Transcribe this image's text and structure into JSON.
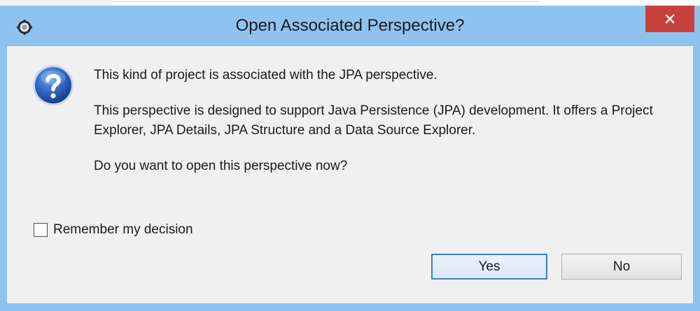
{
  "window": {
    "title": "Open Associated Perspective?",
    "close_glyph": "✕"
  },
  "colors": {
    "titlebar": "#8fc3ef",
    "close_button": "#c7413a",
    "client_background": "#f0f0f0",
    "default_button_border": "#3c7fd1"
  },
  "icons": {
    "app": "eclipse-gear-icon",
    "message": "question-mark-icon",
    "close": "close-icon"
  },
  "message": {
    "line1": "This kind of project is associated with the JPA perspective.",
    "line2": "This perspective is designed to support Java Persistence (JPA) development. It offers a Project Explorer, JPA Details, JPA Structure and a Data Source Explorer.",
    "line3": "Do you want to open this perspective now?"
  },
  "remember": {
    "label": "Remember my decision",
    "checked": false
  },
  "buttons": {
    "yes": "Yes",
    "no": "No"
  }
}
